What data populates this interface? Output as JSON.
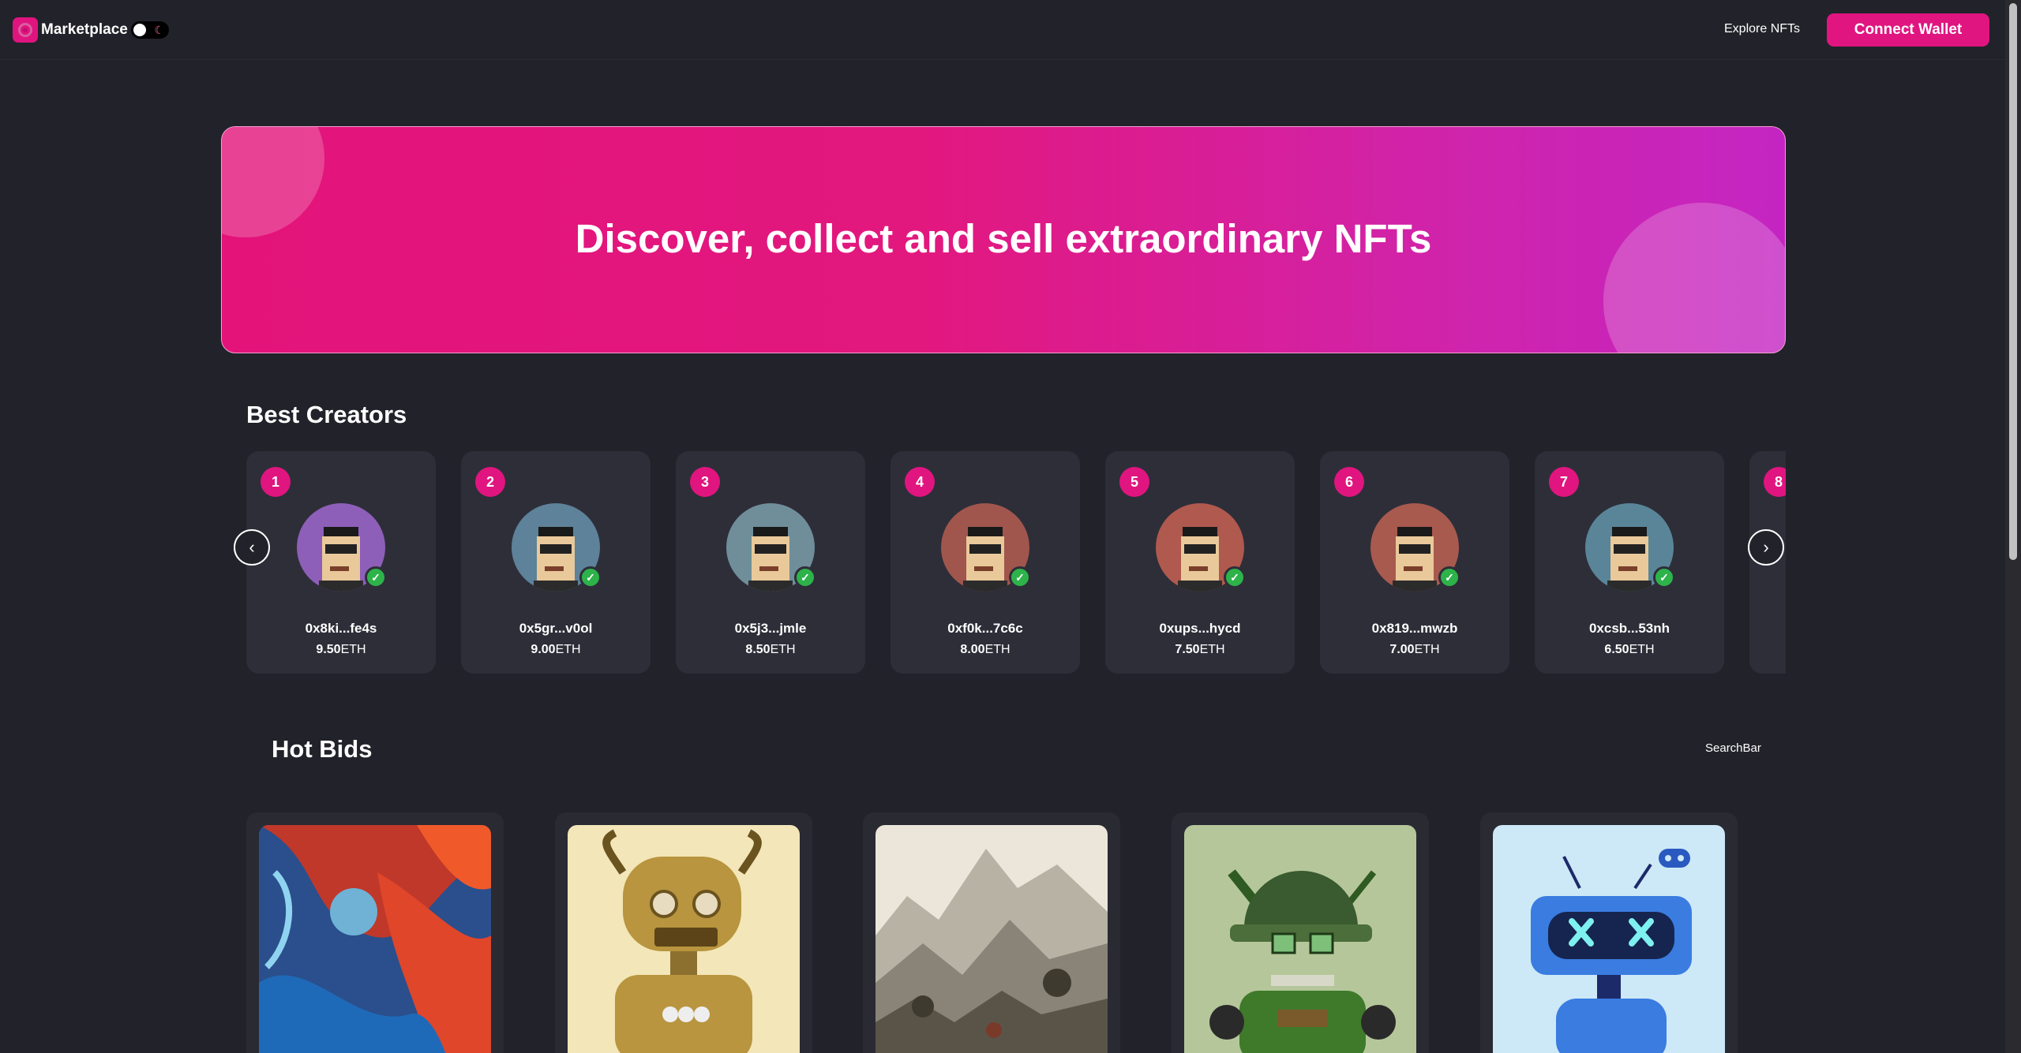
{
  "nav": {
    "brand": "Marketplace",
    "explore_link": "Explore NFTs",
    "connect_wallet": "Connect Wallet",
    "theme_moon": "☾"
  },
  "hero": {
    "title": "Discover, collect and sell extraordinary NFTs"
  },
  "creators": {
    "title": "Best Creators",
    "currency": "ETH",
    "items": [
      {
        "rank": "1",
        "name": "0x8ki...fe4s",
        "amount": "9.50",
        "bg": "#8e5fb8"
      },
      {
        "rank": "2",
        "name": "0x5gr...v0ol",
        "amount": "9.00",
        "bg": "#5d8299"
      },
      {
        "rank": "3",
        "name": "0x5j3...jmle",
        "amount": "8.50",
        "bg": "#6f8e99"
      },
      {
        "rank": "4",
        "name": "0xf0k...7c6c",
        "amount": "8.00",
        "bg": "#a0564d"
      },
      {
        "rank": "5",
        "name": "0xups...hycd",
        "amount": "7.50",
        "bg": "#b0594e"
      },
      {
        "rank": "6",
        "name": "0x819...mwzb",
        "amount": "7.00",
        "bg": "#a85a4f"
      },
      {
        "rank": "7",
        "name": "0xcsb...53nh",
        "amount": "6.50",
        "bg": "#5a8599"
      },
      {
        "rank": "8",
        "name": "",
        "amount": "",
        "bg": "#8e5fb8"
      }
    ],
    "arrow_left": "‹",
    "arrow_right": "›"
  },
  "hot_bids": {
    "title": "Hot Bids",
    "search_label": "SearchBar"
  }
}
